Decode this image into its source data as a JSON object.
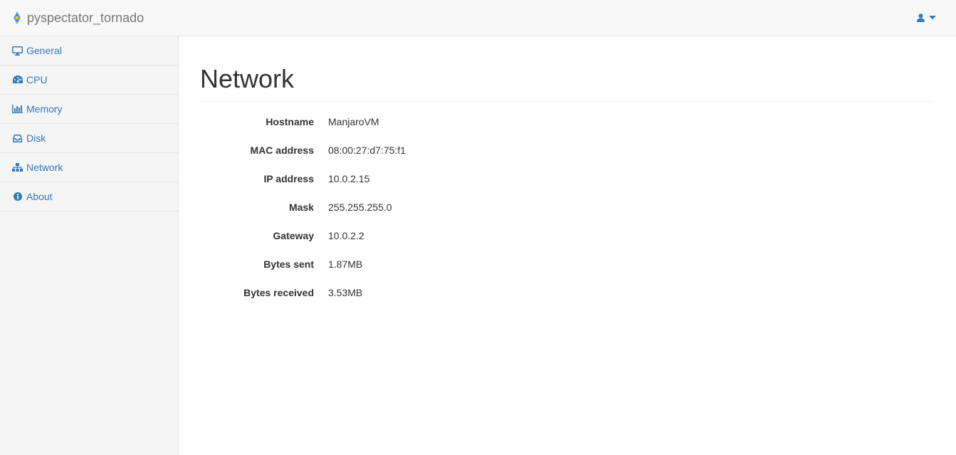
{
  "header": {
    "brand": "pyspectator_tornado",
    "user_icon": "user-icon",
    "caret_icon": "caret-down-icon"
  },
  "sidebar": {
    "items": [
      {
        "label": "General",
        "icon": "desktop-icon"
      },
      {
        "label": "CPU",
        "icon": "dashboard-icon"
      },
      {
        "label": "Memory",
        "icon": "bar-chart-icon"
      },
      {
        "label": "Disk",
        "icon": "inbox-icon"
      },
      {
        "label": "Network",
        "icon": "sitemap-icon"
      },
      {
        "label": "About",
        "icon": "info-circle-icon"
      }
    ]
  },
  "main": {
    "title": "Network",
    "rows": [
      {
        "label": "Hostname",
        "value": "ManjaroVM"
      },
      {
        "label": "MAC address",
        "value": "08:00:27:d7:75:f1"
      },
      {
        "label": "IP address",
        "value": "10.0.2.15"
      },
      {
        "label": "Mask",
        "value": "255.255.255.0"
      },
      {
        "label": "Gateway",
        "value": "10.0.2.2"
      },
      {
        "label": "Bytes sent",
        "value": "1.87MB"
      },
      {
        "label": "Bytes received",
        "value": "3.53MB"
      }
    ]
  },
  "colors": {
    "link": "#337ab7",
    "navbar_bg": "#f8f8f8",
    "sidebar_bg": "#f5f5f5"
  }
}
